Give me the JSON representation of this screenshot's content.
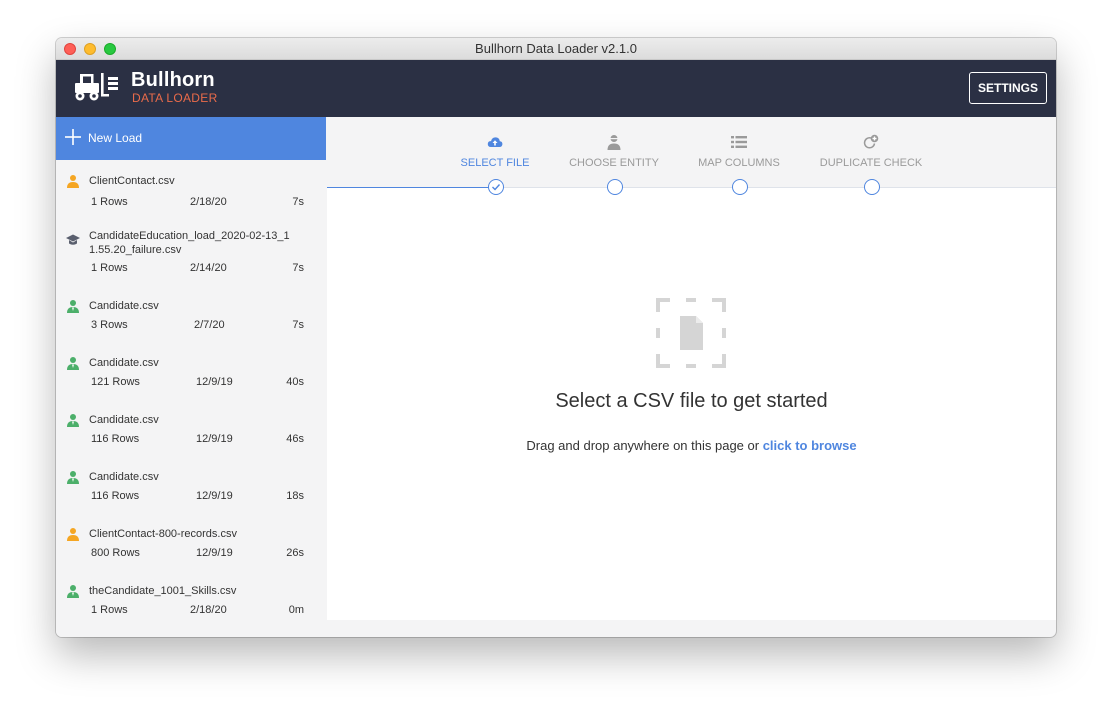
{
  "window": {
    "title": "Bullhorn Data Loader v2.1.0"
  },
  "header": {
    "brand": "Bullhorn",
    "brand_sub": "DATA LOADER",
    "settings_label": "SETTINGS"
  },
  "sidebar": {
    "new_load_label": "New Load",
    "items": [
      {
        "name": "ClientContact.csv",
        "rows": "1 Rows",
        "date": "2/18/20",
        "duration": "7s",
        "icon": "contact-person-icon",
        "icon_color": "#f5a623"
      },
      {
        "name": "CandidateEducation_load_2020-02-13_1 1.55.20_failure.csv",
        "rows": "1 Rows",
        "date": "2/14/20",
        "duration": "7s",
        "icon": "graduation-cap-icon",
        "icon_color": "#5a5f6e"
      },
      {
        "name": "Candidate.csv",
        "rows": "3 Rows",
        "date": "2/7/20",
        "duration": "7s",
        "icon": "candidate-person-icon",
        "icon_color": "#4caf6a"
      },
      {
        "name": "Candidate.csv",
        "rows": "121 Rows",
        "date": "12/9/19",
        "duration": "40s",
        "icon": "candidate-person-icon",
        "icon_color": "#4caf6a"
      },
      {
        "name": "Candidate.csv",
        "rows": "116 Rows",
        "date": "12/9/19",
        "duration": "46s",
        "icon": "candidate-person-icon",
        "icon_color": "#4caf6a"
      },
      {
        "name": "Candidate.csv",
        "rows": "116 Rows",
        "date": "12/9/19",
        "duration": "18s",
        "icon": "candidate-person-icon",
        "icon_color": "#4caf6a"
      },
      {
        "name": "ClientContact-800-records.csv",
        "rows": "800 Rows",
        "date": "12/9/19",
        "duration": "26s",
        "icon": "contact-person-icon",
        "icon_color": "#f5a623"
      },
      {
        "name": "theCandidate_1001_Skills.csv",
        "rows": "1 Rows",
        "date": "2/18/20",
        "duration": "0m",
        "icon": "candidate-person-icon",
        "icon_color": "#4caf6a"
      }
    ]
  },
  "steps": [
    {
      "label": "SELECT FILE",
      "icon": "cloud-upload-icon",
      "state": "active"
    },
    {
      "label": "CHOOSE ENTITY",
      "icon": "person-icon",
      "state": "pending"
    },
    {
      "label": "MAP COLUMNS",
      "icon": "list-icon",
      "state": "pending"
    },
    {
      "label": "DUPLICATE CHECK",
      "icon": "refresh-plus-icon",
      "state": "pending"
    }
  ],
  "main": {
    "headline": "Select a CSV file to get started",
    "subline_prefix": "Drag and drop anywhere on this page or ",
    "browse_link": "click to browse"
  },
  "colors": {
    "accent": "#4f86df",
    "header_bg": "#2b3044",
    "brand_sub": "#ea6b4a",
    "contact": "#f5a623",
    "candidate": "#4caf6a"
  }
}
